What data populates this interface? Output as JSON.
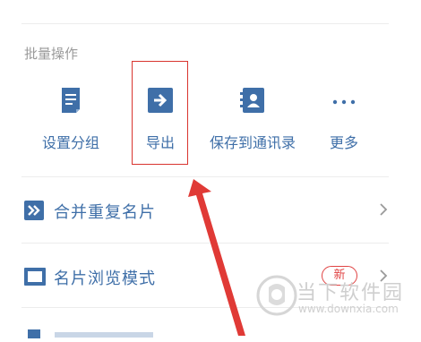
{
  "batch": {
    "title": "批量操作",
    "actions": [
      {
        "label": "设置分组",
        "icon": "document-icon"
      },
      {
        "label": "导出",
        "icon": "export-icon"
      },
      {
        "label": "保存到通讯录",
        "icon": "contact-book-icon"
      },
      {
        "label": "更多",
        "icon": "more-icon"
      }
    ]
  },
  "menu": {
    "items": [
      {
        "label": "合并重复名片",
        "icon": "merge-icon"
      },
      {
        "label": "名片浏览模式",
        "icon": "card-view-icon",
        "badge": "新"
      }
    ]
  },
  "watermark": {
    "brand": "当下软件园",
    "url": "www.downxia.com"
  },
  "colors": {
    "accent": "#3f6fa8",
    "highlight": "#d9342f",
    "badge": "#e04444"
  }
}
